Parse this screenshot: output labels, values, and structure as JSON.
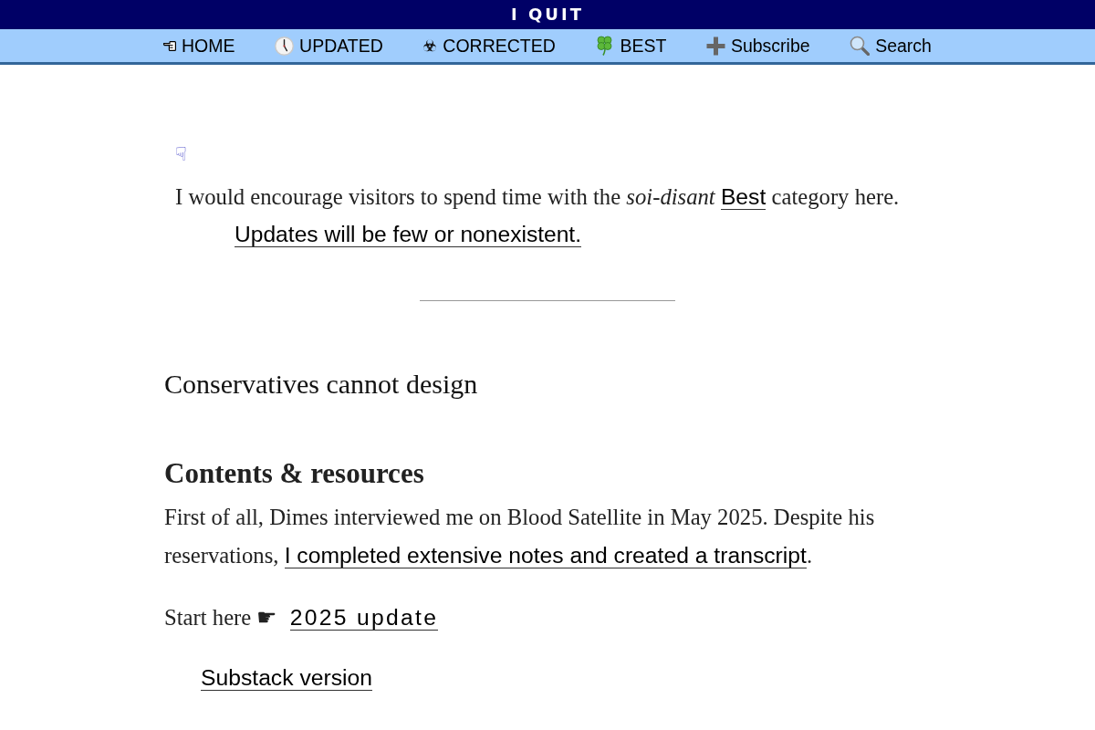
{
  "site_title": "I QUIT",
  "nav": [
    {
      "label": "HOME"
    },
    {
      "label": "UPDATED"
    },
    {
      "label": "CORRECTED"
    },
    {
      "label": "BEST"
    },
    {
      "label": "Subscribe"
    },
    {
      "label": "Search"
    }
  ],
  "notice": {
    "marker": "☟",
    "before": "I would encourage visitors to spend time with the *soi-disant* ",
    "link": "Best",
    "after": " category here.",
    "note_link": "Updates will be few or nonexistent."
  },
  "headline": "Conservatives cannot design",
  "section": {
    "heading": "Contents & resources",
    "paragraph": {
      "before": "First of all, Dimes interviewed me on Blood Satellite in May 2025. Despite his reservations, ",
      "link": "I completed extensive notes and created a transcript",
      "after": "."
    },
    "start_here": {
      "text": "Start here ☛ ",
      "link": "2025 update"
    },
    "extra_link": "Substack version"
  }
}
